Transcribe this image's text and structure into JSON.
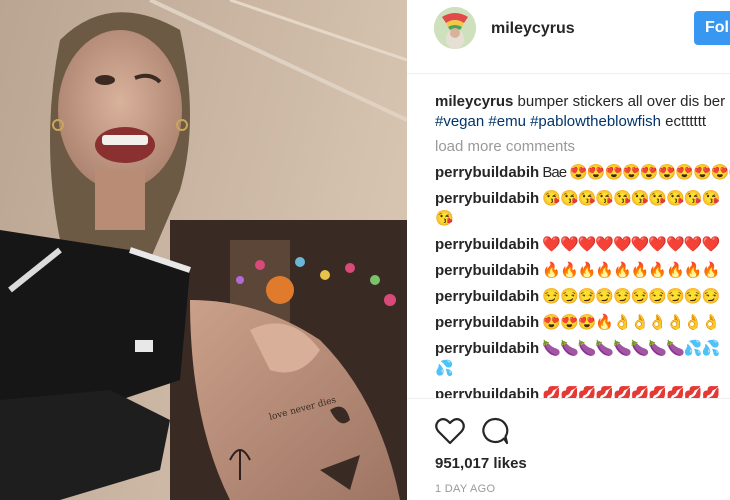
{
  "post": {
    "username": "mileycyrus",
    "follow_label": "Foll",
    "caption_user": "mileycyrus",
    "caption_text": " bumper stickers all over dis ber",
    "hashtags": [
      "#vegan",
      "#emu",
      "#pablowtheblowfish"
    ],
    "caption_tail": " ectttttt",
    "load_more": "load more comments",
    "comments": [
      {
        "user": "perrybuildabih",
        "text": " Bae 😍😍😍😍😍😍😍😍😍😘"
      },
      {
        "user": "perrybuildabih",
        "text": " 😘😘😘😘😘😘😘😘😘😘",
        "text2": "😘"
      },
      {
        "user": "perrybuildabih",
        "text": " ❤️❤️❤️❤️❤️❤️❤️❤️❤️❤️"
      },
      {
        "user": "perrybuildabih",
        "text": " 🔥🔥🔥🔥🔥🔥🔥🔥🔥🔥"
      },
      {
        "user": "perrybuildabih",
        "text": " 😏😏😏😏😏😏😏😏😏😏"
      },
      {
        "user": "perrybuildabih",
        "text": " 😍😍😍🔥👌👌👌👌👌👌"
      },
      {
        "user": "perrybuildabih",
        "text": " 🍆🍆🍆🍆🍆🍆🍆🍆💦💦",
        "text2": "💦"
      },
      {
        "user": "perrybuildabih",
        "text": " 💋💋💋💋💋💋💋💋💋💋"
      }
    ],
    "likes": "951,017 likes",
    "date": "1 DAY AGO"
  },
  "icons": {
    "like": "heart-icon",
    "comment": "comment-bubble-icon"
  }
}
